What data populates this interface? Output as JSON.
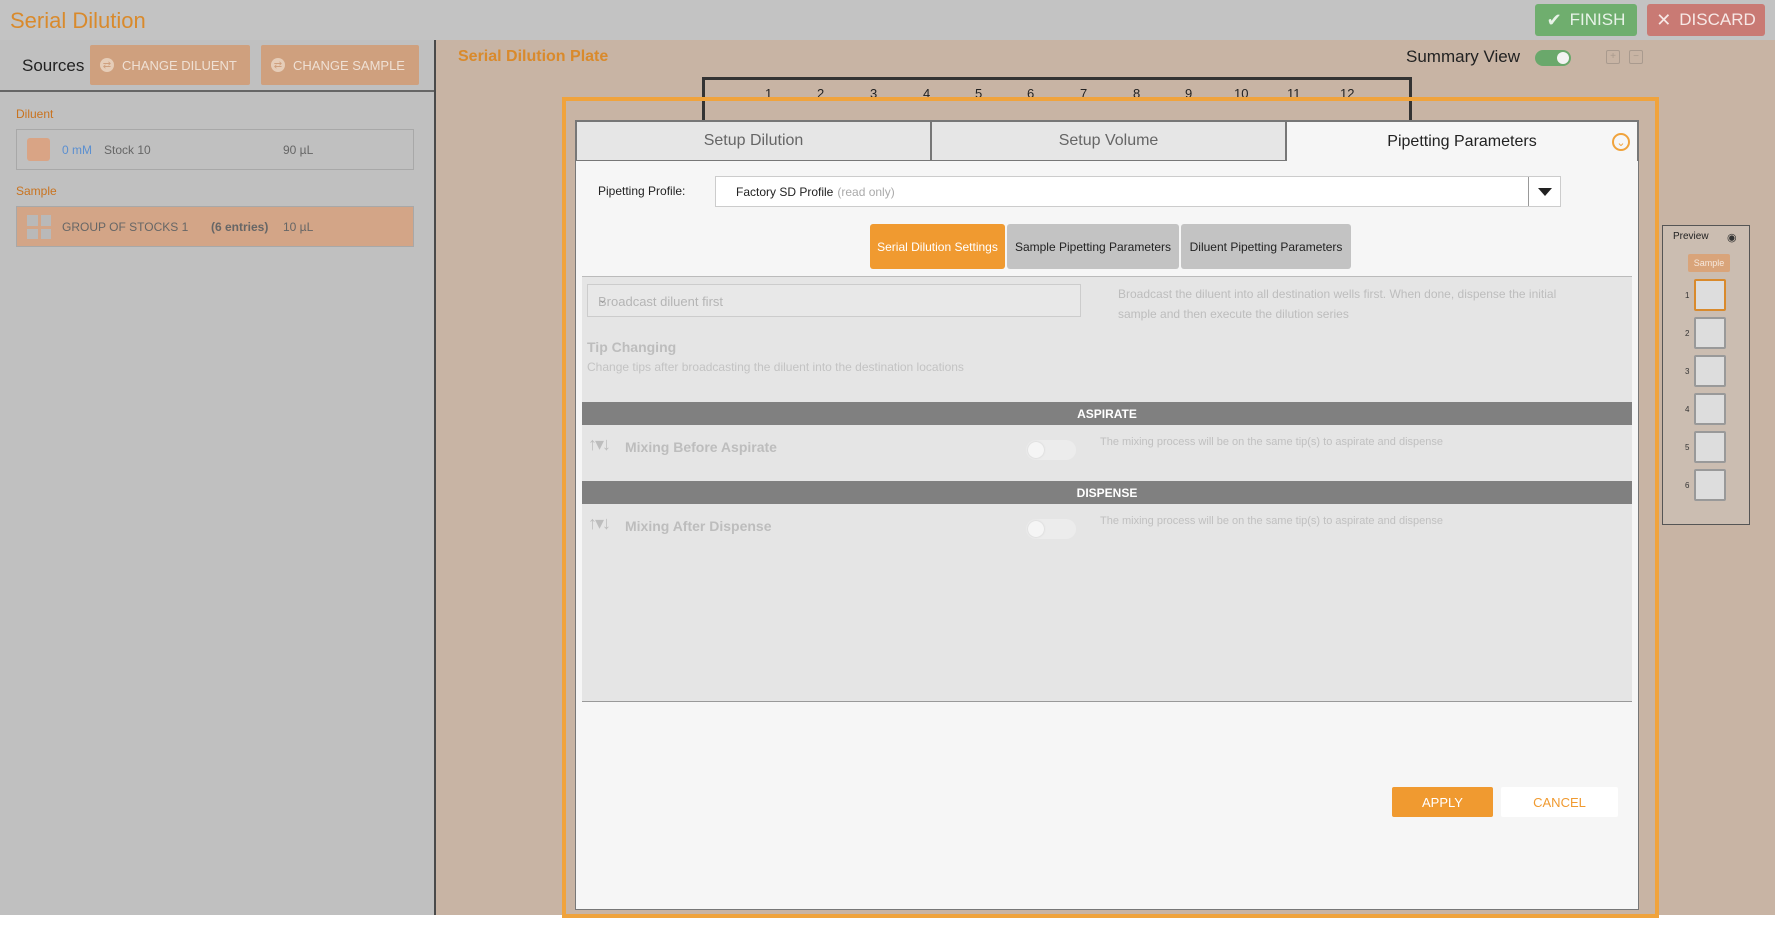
{
  "header": {
    "title": "Serial Dilution",
    "finish_label": "FINISH",
    "discard_label": "DISCARD",
    "finish_icon": "check-icon",
    "discard_icon": "close-icon"
  },
  "sources": {
    "label": "Sources",
    "change_diluent_label": "CHANGE DILUENT",
    "change_sample_label": "CHANGE SAMPLE",
    "diluent_section": "Diluent",
    "diluent": {
      "concentration": "0 mM",
      "name": "Stock 10",
      "volume": "90 µL",
      "color": "#d9a485"
    },
    "sample_section": "Sample",
    "sample": {
      "name": "GROUP OF STOCKS 1",
      "entries": "(6 entries)",
      "volume": "10 µL"
    }
  },
  "plate": {
    "title": "Serial Dilution Plate",
    "summary_label": "Summary View",
    "summary_on": true,
    "columns": [
      "1",
      "2",
      "3",
      "4",
      "5",
      "6",
      "7",
      "8",
      "9",
      "10",
      "11",
      "12"
    ]
  },
  "preview": {
    "label": "Preview",
    "sample_label": "Sample",
    "items": [
      "1",
      "2",
      "3",
      "4",
      "5",
      "6"
    ]
  },
  "modal": {
    "tabs": [
      "Setup Dilution",
      "Setup Volume",
      "Pipetting Parameters"
    ],
    "active_tab": "Pipetting Parameters",
    "profile_label": "Pipetting Profile:",
    "profile_value": "Factory SD Profile",
    "profile_note": "(read only)",
    "subtabs": [
      "Serial Dilution Settings",
      "Sample Pipetting Parameters",
      "Diluent Pipetting Parameters"
    ],
    "active_subtab": "Serial Dilution Settings",
    "broadcast_value": "Broadcast diluent first",
    "broadcast_desc": "Broadcast the diluent into all destination wells first. When done, dispense the initial sample and then execute the dilution series",
    "tip_changing_title": "Tip Changing",
    "tip_changing_desc": "Change tips after broadcasting the diluent into the destination locations",
    "aspirate_header": "ASPIRATE",
    "mixing_before_label": "Mixing Before Aspirate",
    "mixing_before_desc": "The mixing process will be on the same tip(s) to aspirate and dispense",
    "dispense_header": "DISPENSE",
    "mixing_after_label": "Mixing After Dispense",
    "mixing_after_desc": "The mixing process will be on the same tip(s) to aspirate and dispense",
    "apply_label": "APPLY",
    "cancel_label": "CANCEL"
  },
  "colors": {
    "accent": "#f09a30",
    "brand_title": "#d98a2c",
    "finish": "#6fae6e",
    "discard": "#c97a74"
  }
}
